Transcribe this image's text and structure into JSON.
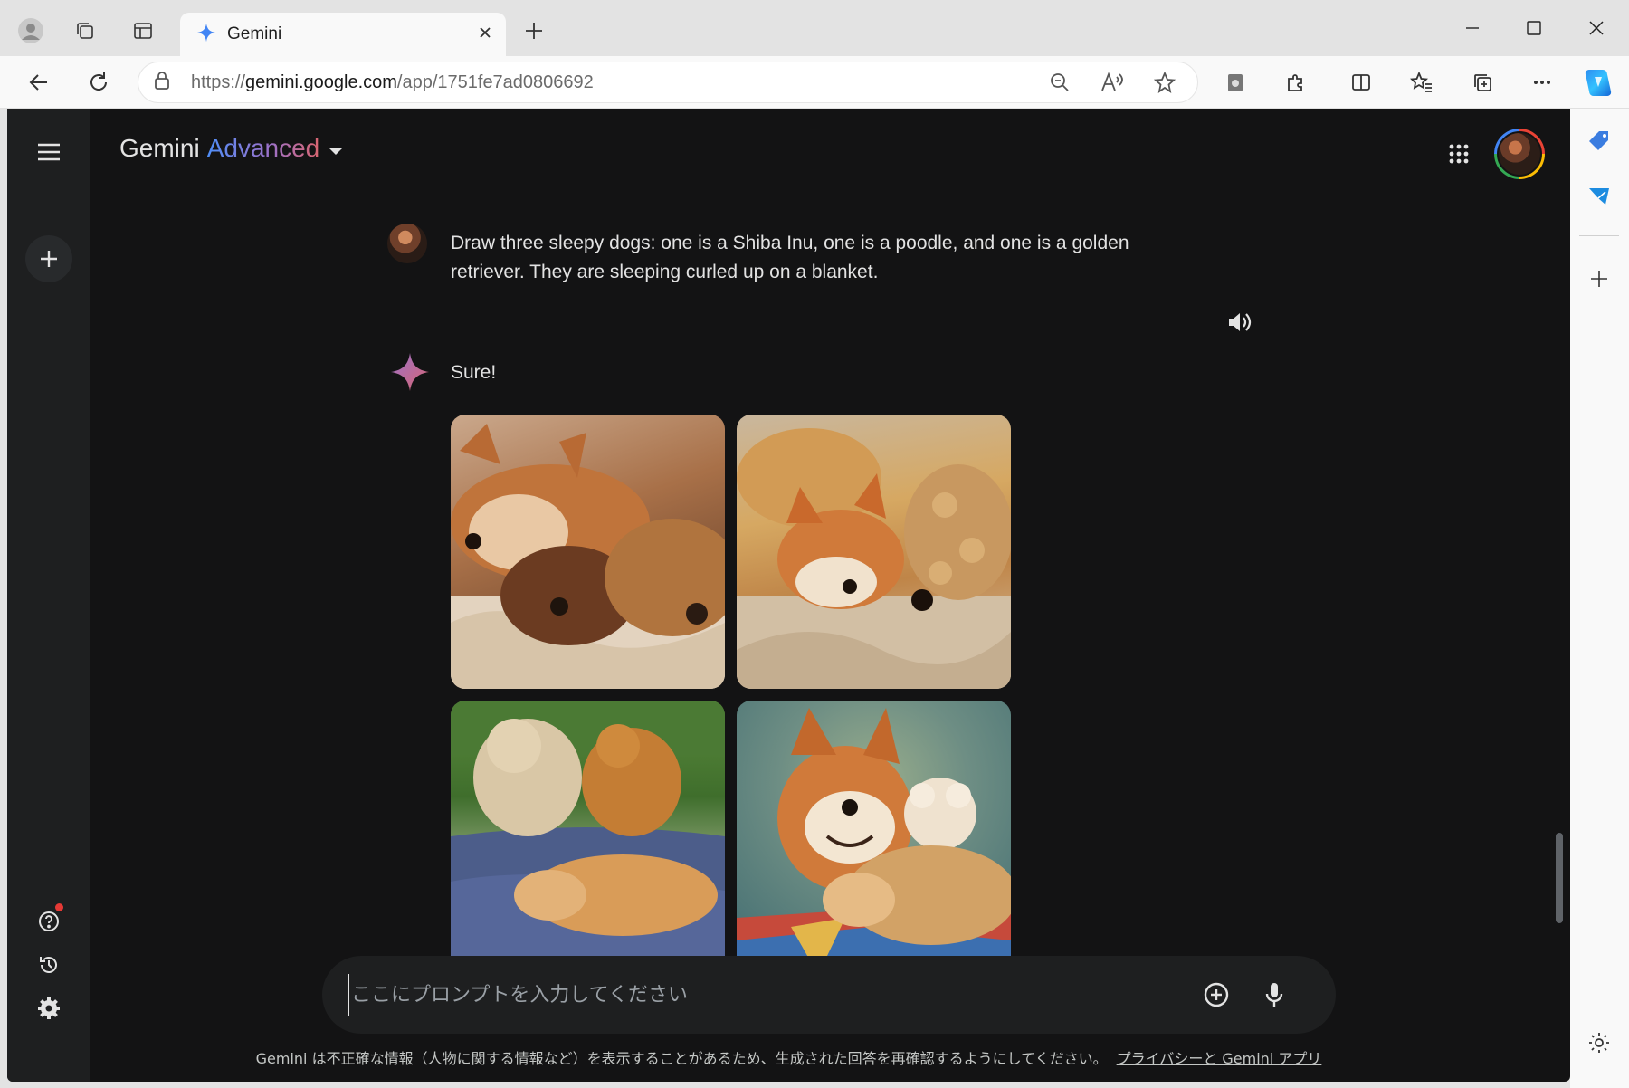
{
  "browser": {
    "tab": {
      "title": "Gemini"
    },
    "address": {
      "url_prefix": "https://",
      "url_domain": "gemini.google.com",
      "url_path": "/app/1751fe7ad0806692"
    }
  },
  "app": {
    "brand": {
      "name": "Gemini",
      "tier": "Advanced"
    },
    "conversation": {
      "user_message": "Draw three sleepy dogs: one is a Shiba Inu, one is a poodle, and one is a golden retriever. They are sleeping curled up on a blanket.",
      "reply_text": "Sure!",
      "images": [
        {
          "name": "generated-image-1"
        },
        {
          "name": "generated-image-2"
        },
        {
          "name": "generated-image-3"
        },
        {
          "name": "generated-image-4"
        }
      ]
    },
    "prompt": {
      "placeholder": "ここにプロンプトを入力してください"
    },
    "disclaimer": {
      "text": "Gemini は不正確な情報（人物に関する情報など）を表示することがあるため、生成された回答を再確認するようにしてください。",
      "link": "プライバシーと Gemini アプリ"
    }
  },
  "colors": {
    "background": "#131314",
    "rail": "#1e1f20",
    "text": "#e3e3e3",
    "accent_blue": "#4f8ef7",
    "accent_pink": "#d96570"
  }
}
